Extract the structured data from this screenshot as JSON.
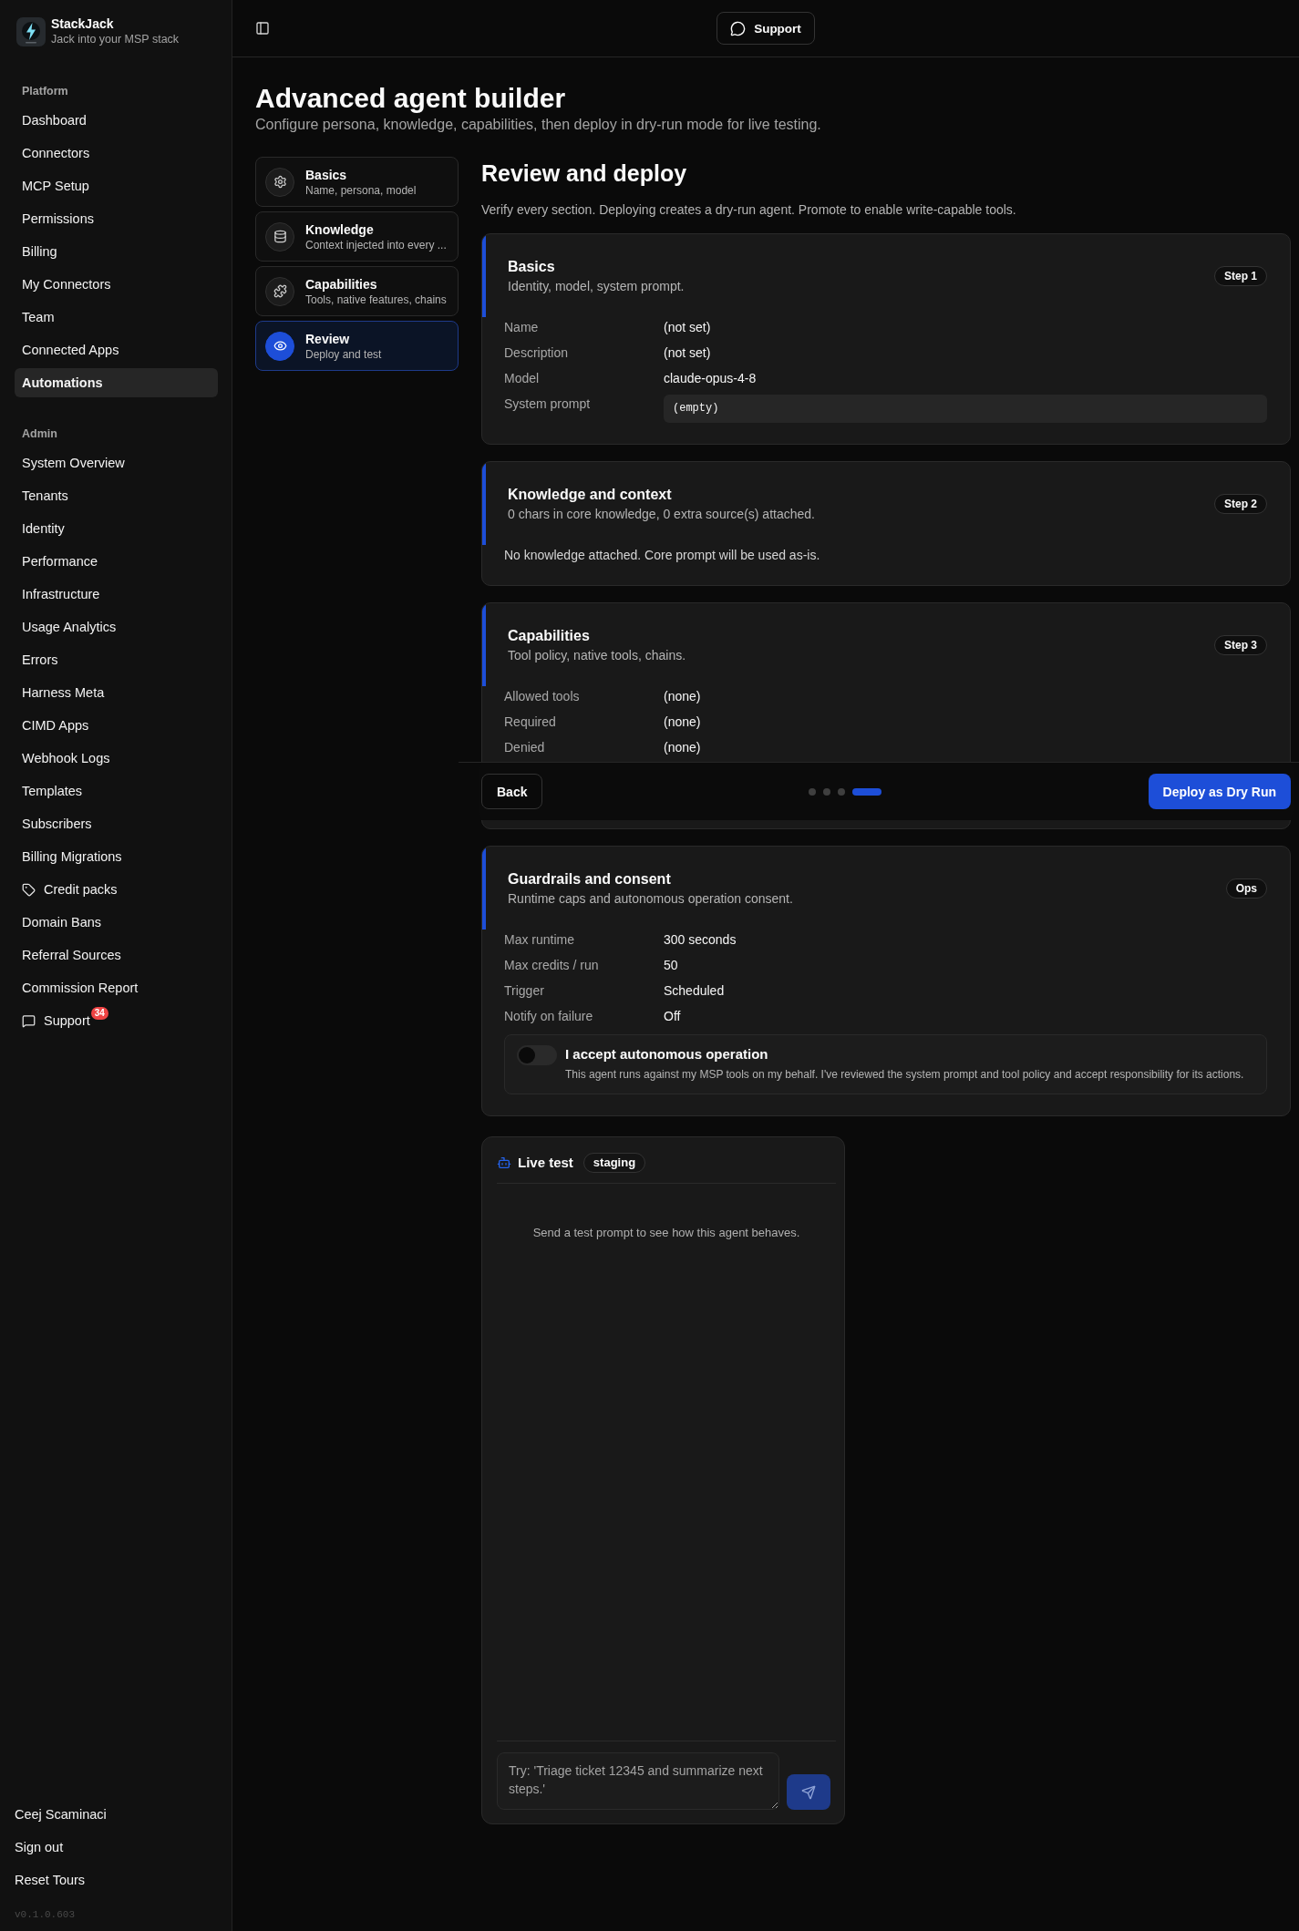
{
  "sidebar": {
    "brand": {
      "name": "StackJack",
      "tagline": "Jack into your MSP stack"
    },
    "sections": [
      {
        "heading": "Platform",
        "items": [
          {
            "label": "Dashboard",
            "kind": "plain",
            "selected": false
          },
          {
            "label": "Connectors",
            "kind": "plain",
            "selected": false
          },
          {
            "label": "MCP Setup",
            "kind": "plain",
            "selected": false
          },
          {
            "label": "Permissions",
            "kind": "plain",
            "selected": false
          },
          {
            "label": "Billing",
            "kind": "plain",
            "selected": false
          },
          {
            "label": "My Connectors",
            "kind": "plain",
            "selected": false
          },
          {
            "label": "Team",
            "kind": "plain",
            "selected": false
          },
          {
            "label": "Connected Apps",
            "kind": "plain",
            "selected": false
          },
          {
            "label": "Automations",
            "kind": "plain",
            "selected": true
          }
        ]
      },
      {
        "heading": "Admin",
        "items": [
          {
            "label": "System Overview",
            "kind": "plain",
            "selected": false
          },
          {
            "label": "Tenants",
            "kind": "plain",
            "selected": false
          },
          {
            "label": "Identity",
            "kind": "plain",
            "selected": false
          },
          {
            "label": "Performance",
            "kind": "plain",
            "selected": false
          },
          {
            "label": "Infrastructure",
            "kind": "plain",
            "selected": false
          },
          {
            "label": "Usage Analytics",
            "kind": "plain",
            "selected": false
          },
          {
            "label": "Errors",
            "kind": "plain",
            "selected": false
          },
          {
            "label": "Harness Meta",
            "kind": "plain",
            "selected": false
          },
          {
            "label": "CIMD Apps",
            "kind": "plain",
            "selected": false
          },
          {
            "label": "Webhook Logs",
            "kind": "plain",
            "selected": false
          },
          {
            "label": "Templates",
            "kind": "plain",
            "selected": false
          },
          {
            "label": "Subscribers",
            "kind": "plain",
            "selected": false
          },
          {
            "label": "Billing Migrations",
            "kind": "plain",
            "selected": false
          },
          {
            "label": "Credit packs",
            "kind": "credits",
            "selected": false
          },
          {
            "label": "Domain Bans",
            "kind": "plain",
            "selected": false
          },
          {
            "label": "Referral Sources",
            "kind": "plain",
            "selected": false
          },
          {
            "label": "Commission Report",
            "kind": "plain",
            "selected": false
          },
          {
            "label": "Support",
            "kind": "support",
            "badge": "34",
            "selected": false
          }
        ]
      }
    ],
    "account": [
      "Ceej Scaminaci",
      "Sign out",
      "Reset Tours"
    ],
    "version": "v0.1.0.603"
  },
  "topbar": {
    "support_button": "Support"
  },
  "page": {
    "title": "Advanced agent builder",
    "subtitle": "Configure persona, knowledge, capabilities, then deploy in dry-run mode for live testing."
  },
  "steps": [
    {
      "title": "Basics",
      "subtitle": "Name, persona, model",
      "selected": false
    },
    {
      "title": "Knowledge",
      "subtitle": "Context injected into every ...",
      "selected": false
    },
    {
      "title": "Capabilities",
      "subtitle": "Tools, native features, chains",
      "selected": false
    },
    {
      "title": "Review",
      "subtitle": "Deploy and test",
      "selected": true
    }
  ],
  "review": {
    "title": "Review and deploy",
    "description": "Verify every section. Deploying creates a dry-run agent. Promote to enable write-capable tools.",
    "sections": [
      {
        "title": "Basics",
        "subtitle": "Identity, model, system prompt.",
        "badge": "Step 1",
        "rows": [
          {
            "label": "Name",
            "value": "(not set)",
            "kind": "text"
          },
          {
            "label": "Description",
            "value": "(not set)",
            "kind": "text"
          },
          {
            "label": "Model",
            "value": "claude-opus-4-8",
            "kind": "text"
          },
          {
            "label": "System prompt",
            "value": "(empty)",
            "kind": "code"
          }
        ]
      },
      {
        "title": "Knowledge and context",
        "subtitle": "0 chars in core knowledge, 0 extra source(s) attached.",
        "badge": "Step 2",
        "note": "No knowledge attached. Core prompt will be used as-is."
      },
      {
        "title": "Capabilities",
        "subtitle": "Tool policy, native tools, chains.",
        "badge": "Step 3",
        "rows": [
          {
            "label": "Allowed tools",
            "value": "(none)",
            "kind": "text"
          },
          {
            "label": "Required",
            "value": "(none)",
            "kind": "text"
          },
          {
            "label": "Denied",
            "value": "(none)",
            "kind": "text"
          }
        ]
      },
      {
        "title": "Guardrails and consent",
        "subtitle": "Runtime caps and autonomous operation consent.",
        "badge": "Ops",
        "rows": [
          {
            "label": "Max runtime",
            "value": "300 seconds",
            "kind": "text"
          },
          {
            "label": "Max credits / run",
            "value": "50",
            "kind": "text"
          },
          {
            "label": "Trigger",
            "value": "Scheduled",
            "kind": "text"
          },
          {
            "label": "Notify on failure",
            "value": "Off",
            "kind": "text"
          }
        ],
        "consent": {
          "title": "I accept autonomous operation",
          "text": "This agent runs against my MSP tools on my behalf. I've reviewed the system prompt and tool policy and accept responsibility for its actions.",
          "on": false
        }
      }
    ]
  },
  "footer_bar": {
    "back_button": "Back",
    "progress_dots": [
      {
        "selected": false
      },
      {
        "selected": false
      },
      {
        "selected": false
      },
      {
        "selected": true
      }
    ],
    "deploy_button": "Deploy as Dry Run"
  },
  "live_test": {
    "title": "Live test",
    "badge": "staging",
    "empty_message": "Send a test prompt to see how this agent behaves.",
    "input": {
      "placeholder": "Try: 'Triage ticket 12345 and summarize next steps.'"
    },
    "send_button": {
      "disabled": true
    }
  }
}
